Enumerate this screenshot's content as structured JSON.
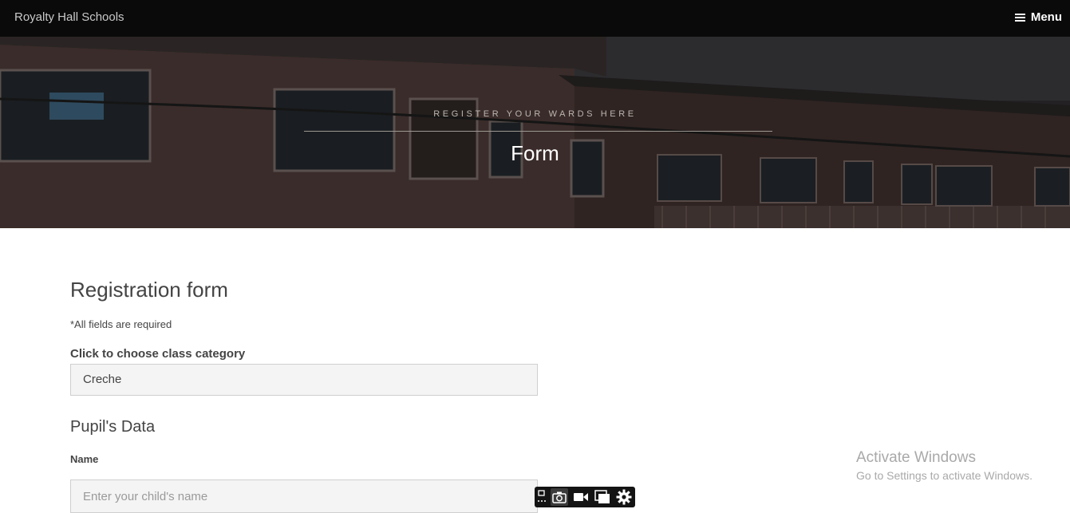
{
  "navbar": {
    "brand": "Royalty Hall Schools",
    "menu_label": "Menu"
  },
  "hero": {
    "subtitle": "REGISTER YOUR WARDS HERE",
    "title": "Form"
  },
  "form": {
    "title": "Registration form",
    "required_note": "*All fields are required",
    "class_category_label": "Click to choose class category",
    "class_category_value": "Creche",
    "section_pupil": "Pupil's Data",
    "name_label": "Name",
    "name_placeholder": "Enter your child's name",
    "name_value": ""
  },
  "watermark": {
    "title": "Activate Windows",
    "subtitle": "Go to Settings to activate Windows."
  },
  "toolbar": {
    "buttons": [
      "selection-icon",
      "camera-icon",
      "video-icon",
      "window-icon",
      "gear-icon"
    ]
  }
}
